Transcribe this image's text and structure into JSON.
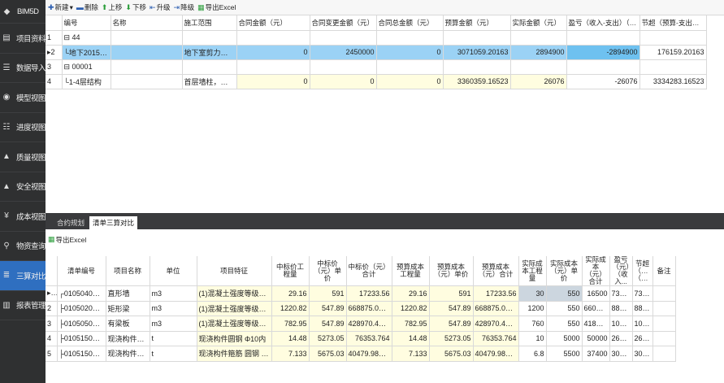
{
  "sidebar": {
    "items": [
      {
        "label": "BIM5D",
        "icon": "cube-icon"
      },
      {
        "label": "项目资料",
        "icon": "folder-icon"
      },
      {
        "label": "数据导入",
        "icon": "import-icon"
      },
      {
        "label": "模型视图",
        "icon": "model-icon"
      },
      {
        "label": "进度视图",
        "icon": "schedule-icon"
      },
      {
        "label": "质量视图",
        "icon": "quality-icon"
      },
      {
        "label": "安全视图",
        "icon": "safety-icon"
      },
      {
        "label": "成本视图",
        "icon": "cost-icon"
      },
      {
        "label": "物资查询",
        "icon": "search-icon"
      },
      {
        "label": "三算对比",
        "icon": "compare-icon"
      },
      {
        "label": "报表管理",
        "icon": "report-icon"
      }
    ],
    "active": 9
  },
  "toolbar": {
    "new": "新建",
    "delete": "删除",
    "up": "上移",
    "down": "下移",
    "promote": "升级",
    "demote": "降级",
    "export": "导出Excel"
  },
  "top_table": {
    "headers": [
      "编号",
      "名称",
      "施工范围",
      "合同金额（元）",
      "合同变更金额（元）",
      "合同总金额（元）",
      "预算金额（元）",
      "实际金额（元）",
      "盈亏（收入-支出）（元）",
      "节超（预算-支出）（元）"
    ],
    "rows": [
      {
        "idx": "1",
        "code": "⊟ 44",
        "name": "",
        "scope": "",
        "contract": "",
        "change": "",
        "total": "",
        "budget": "",
        "actual": "",
        "profit": "",
        "save": ""
      },
      {
        "idx": "▸2",
        "code": "└地下2015-03-25",
        "name": "",
        "scope": "地下室剪力墙柱，梁板钢...",
        "contract": "0",
        "change": "2450000",
        "total": "0",
        "budget": "3071059.20163",
        "actual": "2894900",
        "profit": "-2894900",
        "save": "176159.20163"
      },
      {
        "idx": "3",
        "code": "⊟ 00001",
        "name": "",
        "scope": "",
        "contract": "",
        "change": "",
        "total": "",
        "budget": "",
        "actual": "",
        "profit": "",
        "save": ""
      },
      {
        "idx": "4",
        "code": "└1-4层结构",
        "name": "",
        "scope": "首层墙柱，梁板钢筋混凝...",
        "contract": "0",
        "change": "0",
        "total": "0",
        "budget": "3360359.16523",
        "actual": "26076",
        "profit": "-26076",
        "save": "3334283.16523"
      }
    ]
  },
  "tabs": [
    "合约规划",
    "清单三算对比"
  ],
  "bottom_toolbar": {
    "export": "导出Excel"
  },
  "bottom_table": {
    "headers": [
      "清单编号",
      "项目名称",
      "单位",
      "项目特征",
      "中标价工程量",
      "中标价（元）单价",
      "中标价（元）合计",
      "预算成本工程量",
      "预算成本（元）单价",
      "预算成本（元）合计",
      "实际成本工程量",
      "实际成本（元）单价",
      "实际成本（元）合计",
      "盈亏（元）（收入...",
      "节超（元）（预...",
      "备注"
    ],
    "rows": [
      {
        "idx": "▸1",
        "code": "┌0105040010...",
        "name": "直形墙",
        "unit": "m3",
        "feature": "(1)混凝土强度等级C30",
        "q1": "29.16",
        "p1": "591",
        "t1": "17233.56",
        "q2": "29.16",
        "p2": "591",
        "t2": "17233.56",
        "q3": "30",
        "p3": "550",
        "t3": "16500",
        "pr": "733.56...",
        "sv": "733...."
      },
      {
        "idx": "2",
        "code": "├0105020010...",
        "name": "矩形梁",
        "unit": "m3",
        "feature": "(1)混凝土强度等级C30",
        "q1": "1220.82",
        "p1": "547.89",
        "t1": "668875.0698",
        "q2": "1220.82",
        "p2": "547.89",
        "t2": "668875.0698",
        "q3": "1200",
        "p3": "550",
        "t3": "660000",
        "pr": "8875.0...",
        "sv": "8875...."
      },
      {
        "idx": "3",
        "code": "├0105050010...",
        "name": "有梁板",
        "unit": "m3",
        "feature": "(1)混凝土强度等级C30",
        "q1": "782.95",
        "p1": "547.89",
        "t1": "428970.4755",
        "q2": "782.95",
        "p2": "547.89",
        "t2": "428970.4755",
        "q3": "760",
        "p3": "550",
        "t3": "418000",
        "pr": "10970....",
        "sv": "1097...."
      },
      {
        "idx": "4",
        "code": "├0105150010...",
        "name": "现浇构件钢筋",
        "unit": "t",
        "feature": "现浇构件圆钢 Φ10内",
        "q1": "14.48",
        "p1": "5273.05",
        "t1": "76353.764",
        "q2": "14.48",
        "p2": "5273.05",
        "t2": "76353.764",
        "q3": "10",
        "p3": "5000",
        "t3": "50000",
        "pr": "26353....",
        "sv": "2635...."
      },
      {
        "idx": "5",
        "code": "├0105150010...",
        "name": "现浇构件钢筋",
        "unit": "t",
        "feature": "现浇构件箍筋 圆钢 Φ1...",
        "q1": "7.133",
        "p1": "5675.03",
        "t1": "40479.98899",
        "q2": "7.133",
        "p2": "5675.03",
        "t2": "40479.98899",
        "q3": "6.8",
        "p3": "5500",
        "t3": "37400",
        "pr": "3079.9...",
        "sv": "3079...."
      }
    ]
  }
}
